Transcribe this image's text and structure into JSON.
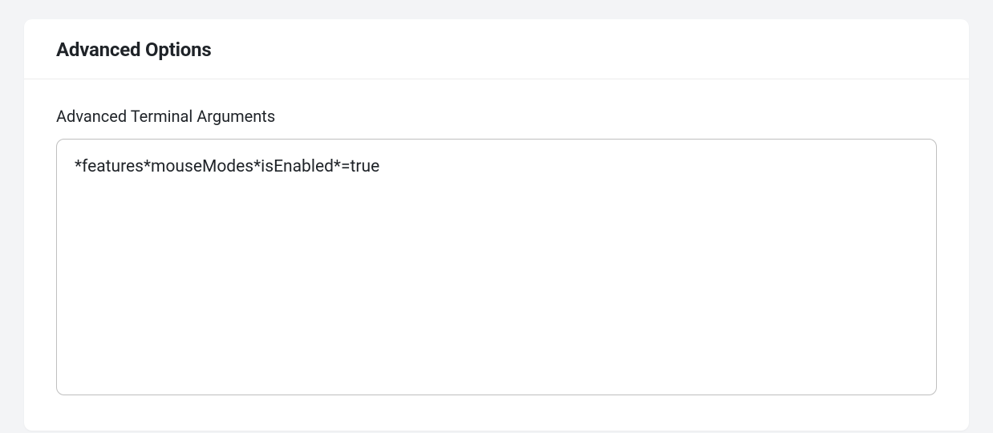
{
  "panel": {
    "title": "Advanced Options",
    "field_label": "Advanced Terminal Arguments",
    "textarea_value": "*features*mouseModes*isEnabled*=true"
  }
}
